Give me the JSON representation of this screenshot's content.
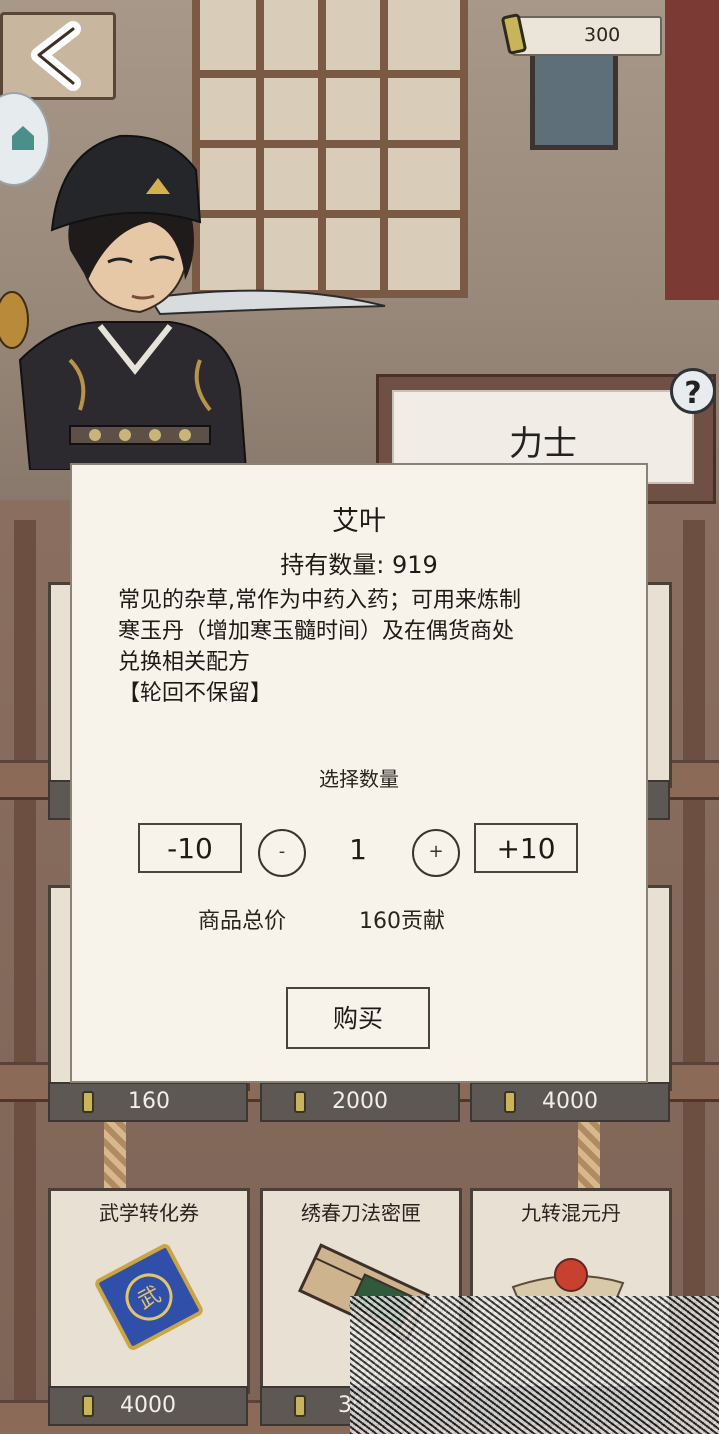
{
  "header": {
    "currency_amount": "300",
    "category_tab": "力士",
    "help_label": "?"
  },
  "dialog": {
    "item_name": "艾叶",
    "owned_label": "持有数量:",
    "owned_count": "919",
    "description_lines": [
      "常见的杂草,常作为中药入药；可用来炼制",
      "寒玉丹（增加寒玉髓时间）及在偶货商处",
      "兑换相关配方",
      "【轮回不保留】"
    ],
    "select_quantity_label": "选择数量",
    "minus10_label": "-10",
    "minus_label": "-",
    "quantity": "1",
    "plus_label": "+",
    "plus10_label": "+10",
    "total_label": "商品总价",
    "total_value": "160贡献",
    "buy_label": "购买"
  },
  "shop": {
    "row2_prices": [
      "160",
      "2000",
      "4000"
    ],
    "row3": [
      {
        "name": "武学转化券",
        "price": "4000"
      },
      {
        "name": "绣春刀法密匣",
        "price": "300"
      },
      {
        "name": "九转混元丹",
        "price": ""
      }
    ]
  }
}
